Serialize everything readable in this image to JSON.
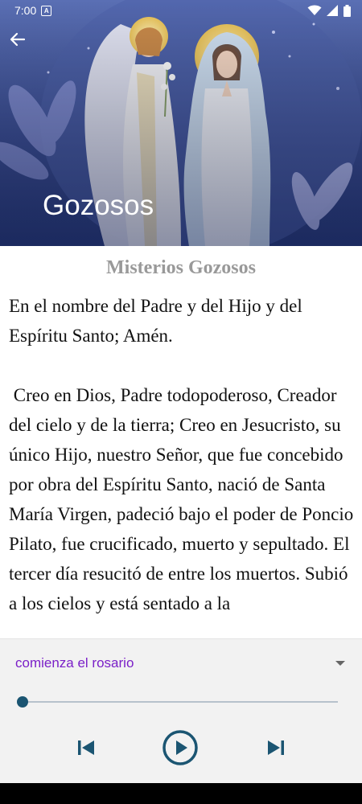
{
  "status_bar": {
    "time": "7:00",
    "notification_icon_label": "A"
  },
  "header": {
    "title": "Gozosos"
  },
  "content": {
    "section_title": "Misterios Gozosos",
    "prayer_text": "En el nombre del Padre y del Hijo y del Espíritu Santo; Amén.\n\n Creo en Dios, Padre todopoderoso, Creador del cielo y de la tierra; Creo en Jesucristo, su único Hijo, nuestro Señor, que fue concebido por obra del Espíritu Santo, nació de Santa María Virgen, padeció bajo el poder de Poncio Pilato, fue crucificado, muerto y sepultado. El tercer día resucitó de entre los muertos. Subió a los cielos y está sentado a la"
  },
  "player": {
    "track_label": "comienza el rosario",
    "progress": 0.0,
    "icons": {
      "previous": "skip-previous-icon",
      "play": "play-circle-icon",
      "next": "skip-next-icon",
      "dropdown": "dropdown-arrow-icon"
    }
  },
  "colors": {
    "accent_text": "#7b20c8",
    "player_accent": "#1b5572",
    "section_title": "#999999"
  }
}
